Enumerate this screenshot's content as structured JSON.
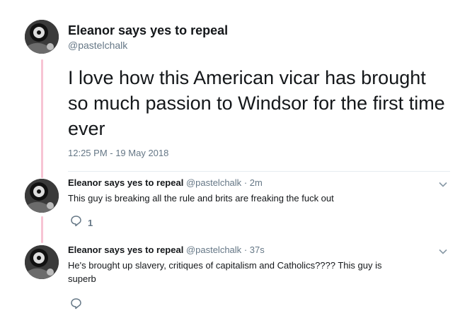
{
  "main_tweet": {
    "display_name": "Eleanor says yes to repeal",
    "handle": "@pastelchalk",
    "text": "I love how this American vicar has brought so much passion to Windsor for the first time ever",
    "timestamp": "12:25 PM - 19 May 2018"
  },
  "replies": [
    {
      "display_name": "Eleanor says yes to repeal",
      "handle": "@pastelchalk",
      "time": "· 2m",
      "text": "This guy is breaking all the rule and brits are freaking the fuck out",
      "reply_count": "1"
    },
    {
      "display_name": "Eleanor says yes to repeal",
      "handle": "@pastelchalk",
      "time": "· 37s",
      "text": "He's brought up slavery, critiques of capitalism and Catholics???? This guy is superb"
    }
  ],
  "colors": {
    "thread_line": "#f7c4d4",
    "text_primary": "#14171a",
    "text_secondary": "#657786",
    "divider": "#e6ecf0"
  },
  "icons": {
    "avatar": "avatar-photo",
    "caret": "chevron-down-icon",
    "reply": "reply-icon"
  }
}
